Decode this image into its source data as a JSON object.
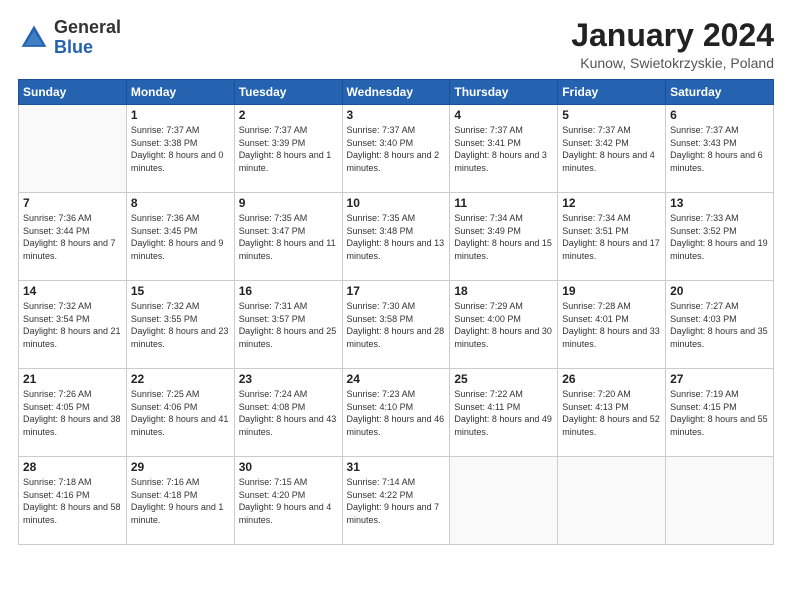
{
  "logo": {
    "general": "General",
    "blue": "Blue"
  },
  "header": {
    "title": "January 2024",
    "location": "Kunow, Swietokrzyskie, Poland"
  },
  "columns": [
    "Sunday",
    "Monday",
    "Tuesday",
    "Wednesday",
    "Thursday",
    "Friday",
    "Saturday"
  ],
  "weeks": [
    [
      {
        "day": "",
        "sunrise": "",
        "sunset": "",
        "daylight": ""
      },
      {
        "day": "1",
        "sunrise": "Sunrise: 7:37 AM",
        "sunset": "Sunset: 3:38 PM",
        "daylight": "Daylight: 8 hours and 0 minutes."
      },
      {
        "day": "2",
        "sunrise": "Sunrise: 7:37 AM",
        "sunset": "Sunset: 3:39 PM",
        "daylight": "Daylight: 8 hours and 1 minute."
      },
      {
        "day": "3",
        "sunrise": "Sunrise: 7:37 AM",
        "sunset": "Sunset: 3:40 PM",
        "daylight": "Daylight: 8 hours and 2 minutes."
      },
      {
        "day": "4",
        "sunrise": "Sunrise: 7:37 AM",
        "sunset": "Sunset: 3:41 PM",
        "daylight": "Daylight: 8 hours and 3 minutes."
      },
      {
        "day": "5",
        "sunrise": "Sunrise: 7:37 AM",
        "sunset": "Sunset: 3:42 PM",
        "daylight": "Daylight: 8 hours and 4 minutes."
      },
      {
        "day": "6",
        "sunrise": "Sunrise: 7:37 AM",
        "sunset": "Sunset: 3:43 PM",
        "daylight": "Daylight: 8 hours and 6 minutes."
      }
    ],
    [
      {
        "day": "7",
        "sunrise": "Sunrise: 7:36 AM",
        "sunset": "Sunset: 3:44 PM",
        "daylight": "Daylight: 8 hours and 7 minutes."
      },
      {
        "day": "8",
        "sunrise": "Sunrise: 7:36 AM",
        "sunset": "Sunset: 3:45 PM",
        "daylight": "Daylight: 8 hours and 9 minutes."
      },
      {
        "day": "9",
        "sunrise": "Sunrise: 7:35 AM",
        "sunset": "Sunset: 3:47 PM",
        "daylight": "Daylight: 8 hours and 11 minutes."
      },
      {
        "day": "10",
        "sunrise": "Sunrise: 7:35 AM",
        "sunset": "Sunset: 3:48 PM",
        "daylight": "Daylight: 8 hours and 13 minutes."
      },
      {
        "day": "11",
        "sunrise": "Sunrise: 7:34 AM",
        "sunset": "Sunset: 3:49 PM",
        "daylight": "Daylight: 8 hours and 15 minutes."
      },
      {
        "day": "12",
        "sunrise": "Sunrise: 7:34 AM",
        "sunset": "Sunset: 3:51 PM",
        "daylight": "Daylight: 8 hours and 17 minutes."
      },
      {
        "day": "13",
        "sunrise": "Sunrise: 7:33 AM",
        "sunset": "Sunset: 3:52 PM",
        "daylight": "Daylight: 8 hours and 19 minutes."
      }
    ],
    [
      {
        "day": "14",
        "sunrise": "Sunrise: 7:32 AM",
        "sunset": "Sunset: 3:54 PM",
        "daylight": "Daylight: 8 hours and 21 minutes."
      },
      {
        "day": "15",
        "sunrise": "Sunrise: 7:32 AM",
        "sunset": "Sunset: 3:55 PM",
        "daylight": "Daylight: 8 hours and 23 minutes."
      },
      {
        "day": "16",
        "sunrise": "Sunrise: 7:31 AM",
        "sunset": "Sunset: 3:57 PM",
        "daylight": "Daylight: 8 hours and 25 minutes."
      },
      {
        "day": "17",
        "sunrise": "Sunrise: 7:30 AM",
        "sunset": "Sunset: 3:58 PM",
        "daylight": "Daylight: 8 hours and 28 minutes."
      },
      {
        "day": "18",
        "sunrise": "Sunrise: 7:29 AM",
        "sunset": "Sunset: 4:00 PM",
        "daylight": "Daylight: 8 hours and 30 minutes."
      },
      {
        "day": "19",
        "sunrise": "Sunrise: 7:28 AM",
        "sunset": "Sunset: 4:01 PM",
        "daylight": "Daylight: 8 hours and 33 minutes."
      },
      {
        "day": "20",
        "sunrise": "Sunrise: 7:27 AM",
        "sunset": "Sunset: 4:03 PM",
        "daylight": "Daylight: 8 hours and 35 minutes."
      }
    ],
    [
      {
        "day": "21",
        "sunrise": "Sunrise: 7:26 AM",
        "sunset": "Sunset: 4:05 PM",
        "daylight": "Daylight: 8 hours and 38 minutes."
      },
      {
        "day": "22",
        "sunrise": "Sunrise: 7:25 AM",
        "sunset": "Sunset: 4:06 PM",
        "daylight": "Daylight: 8 hours and 41 minutes."
      },
      {
        "day": "23",
        "sunrise": "Sunrise: 7:24 AM",
        "sunset": "Sunset: 4:08 PM",
        "daylight": "Daylight: 8 hours and 43 minutes."
      },
      {
        "day": "24",
        "sunrise": "Sunrise: 7:23 AM",
        "sunset": "Sunset: 4:10 PM",
        "daylight": "Daylight: 8 hours and 46 minutes."
      },
      {
        "day": "25",
        "sunrise": "Sunrise: 7:22 AM",
        "sunset": "Sunset: 4:11 PM",
        "daylight": "Daylight: 8 hours and 49 minutes."
      },
      {
        "day": "26",
        "sunrise": "Sunrise: 7:20 AM",
        "sunset": "Sunset: 4:13 PM",
        "daylight": "Daylight: 8 hours and 52 minutes."
      },
      {
        "day": "27",
        "sunrise": "Sunrise: 7:19 AM",
        "sunset": "Sunset: 4:15 PM",
        "daylight": "Daylight: 8 hours and 55 minutes."
      }
    ],
    [
      {
        "day": "28",
        "sunrise": "Sunrise: 7:18 AM",
        "sunset": "Sunset: 4:16 PM",
        "daylight": "Daylight: 8 hours and 58 minutes."
      },
      {
        "day": "29",
        "sunrise": "Sunrise: 7:16 AM",
        "sunset": "Sunset: 4:18 PM",
        "daylight": "Daylight: 9 hours and 1 minute."
      },
      {
        "day": "30",
        "sunrise": "Sunrise: 7:15 AM",
        "sunset": "Sunset: 4:20 PM",
        "daylight": "Daylight: 9 hours and 4 minutes."
      },
      {
        "day": "31",
        "sunrise": "Sunrise: 7:14 AM",
        "sunset": "Sunset: 4:22 PM",
        "daylight": "Daylight: 9 hours and 7 minutes."
      },
      {
        "day": "",
        "sunrise": "",
        "sunset": "",
        "daylight": ""
      },
      {
        "day": "",
        "sunrise": "",
        "sunset": "",
        "daylight": ""
      },
      {
        "day": "",
        "sunrise": "",
        "sunset": "",
        "daylight": ""
      }
    ]
  ]
}
